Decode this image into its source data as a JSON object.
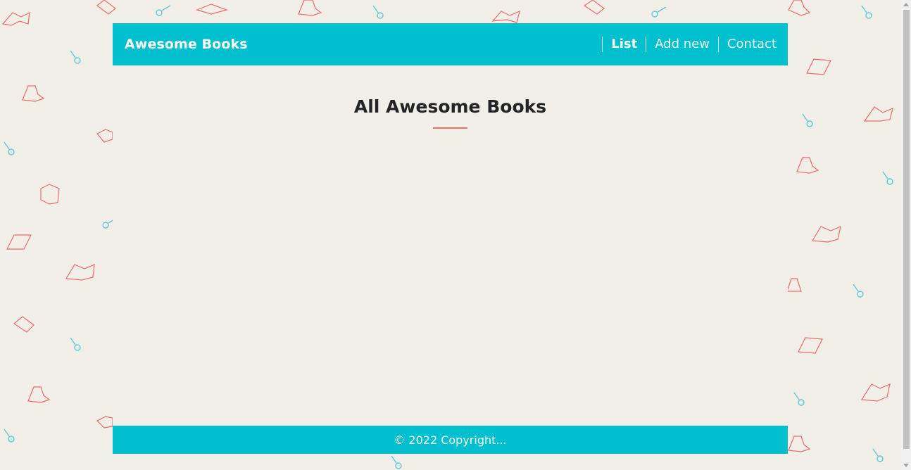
{
  "header": {
    "brand": "Awesome Books",
    "nav": [
      {
        "label": "List",
        "active": true
      },
      {
        "label": "Add new",
        "active": false
      },
      {
        "label": "Contact",
        "active": false
      }
    ]
  },
  "main": {
    "title": "All Awesome Books",
    "books": []
  },
  "footer": {
    "copyright": "© 2022 Copyright..."
  },
  "theme": {
    "accent": "#00bfcf",
    "underline": "#ef6a6a",
    "background": "#f2eee8",
    "doodle_book": "#ef6a6a",
    "doodle_lens": "#5ccad8"
  },
  "decor": {
    "icons": [
      "open-book-icon",
      "magnifier-icon",
      "book-stack-icon"
    ]
  }
}
